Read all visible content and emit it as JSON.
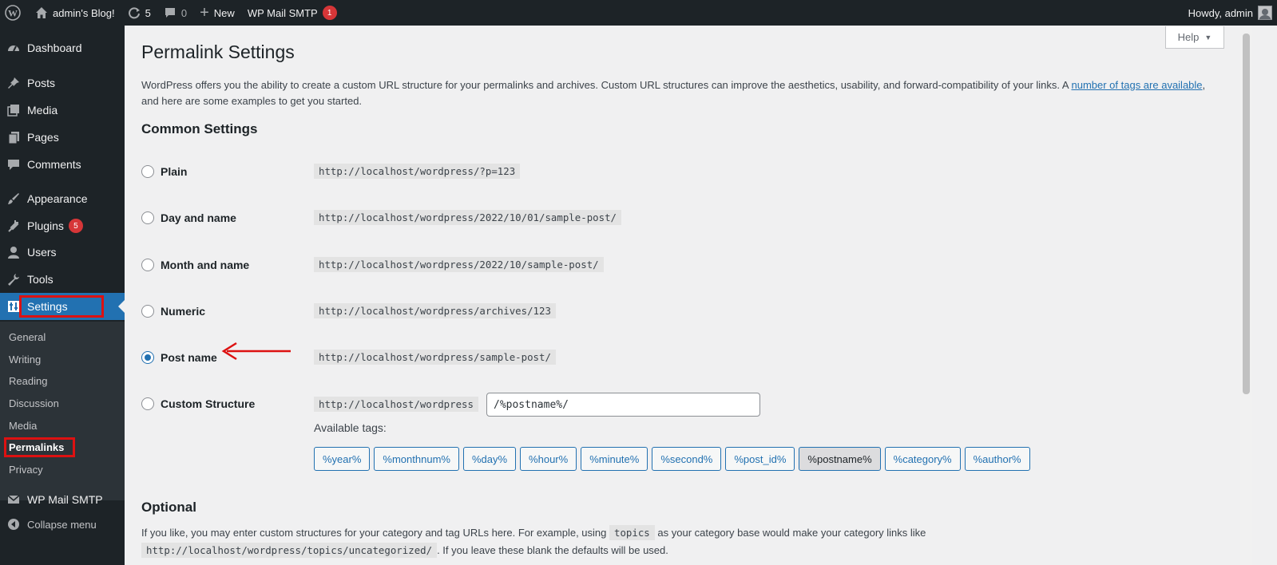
{
  "adminbar": {
    "site_name": "admin's Blog!",
    "updates_count": "5",
    "comments_count": "0",
    "new_label": "New",
    "wp_mail_smtp_label": "WP Mail SMTP",
    "wp_mail_smtp_badge": "1",
    "howdy": "Howdy, admin"
  },
  "sidebar": {
    "items": [
      {
        "label": "Dashboard",
        "icon": "dashboard-icon"
      },
      {
        "label": "Posts",
        "icon": "pin-icon"
      },
      {
        "label": "Media",
        "icon": "media-icon"
      },
      {
        "label": "Pages",
        "icon": "pages-icon"
      },
      {
        "label": "Comments",
        "icon": "comment-icon"
      },
      {
        "label": "Appearance",
        "icon": "brush-icon"
      },
      {
        "label": "Plugins",
        "icon": "plugin-icon",
        "badge": "5"
      },
      {
        "label": "Users",
        "icon": "users-icon"
      },
      {
        "label": "Tools",
        "icon": "wrench-icon"
      },
      {
        "label": "Settings",
        "icon": "settings-icon"
      },
      {
        "label": "WP Mail SMTP",
        "icon": "mail-icon"
      },
      {
        "label": "Collapse menu",
        "icon": "collapse-icon"
      }
    ],
    "submenu": [
      "General",
      "Writing",
      "Reading",
      "Discussion",
      "Media",
      "Permalinks",
      "Privacy"
    ]
  },
  "main": {
    "help_label": "Help",
    "title": "Permalink Settings",
    "intro_text": "WordPress offers you the ability to create a custom URL structure for your permalinks and archives. Custom URL structures can improve the aesthetics, usability, and forward-compatibility of your links. A",
    "intro_link": "number of tags are available",
    "intro_comma": ",",
    "intro_text2": "and here are some examples to get you started.",
    "common_settings": "Common Settings",
    "options": [
      {
        "label": "Plain",
        "example": "http://localhost/wordpress/?p=123",
        "checked": false
      },
      {
        "label": "Day and name",
        "example": "http://localhost/wordpress/2022/10/01/sample-post/",
        "checked": false
      },
      {
        "label": "Month and name",
        "example": "http://localhost/wordpress/2022/10/sample-post/",
        "checked": false
      },
      {
        "label": "Numeric",
        "example": "http://localhost/wordpress/archives/123",
        "checked": false
      },
      {
        "label": "Post name",
        "example": "http://localhost/wordpress/sample-post/",
        "checked": true
      },
      {
        "label": "Custom Structure",
        "example": "http://localhost/wordpress",
        "checked": false
      }
    ],
    "custom_value": "/%postname%/",
    "available_tags_label": "Available tags:",
    "tags": [
      "%year%",
      "%monthnum%",
      "%day%",
      "%hour%",
      "%minute%",
      "%second%",
      "%post_id%",
      "%postname%",
      "%category%",
      "%author%"
    ],
    "active_tag": "%postname%",
    "optional_title": "Optional",
    "optional_text_before": "If you like, you may enter custom structures for your category and tag URLs here. For example, using",
    "optional_code": "topics",
    "optional_text_after": "as your category base would make your category links like",
    "optional_example": "http://localhost/wordpress/topics/uncategorized/",
    "optional_text_end": ". If you leave these blank the defaults will be used."
  },
  "colors": {
    "admin_dark": "#1d2327",
    "accent_blue": "#2271b1",
    "badge_red": "#d63638",
    "annotation_red": "#dd1111"
  }
}
